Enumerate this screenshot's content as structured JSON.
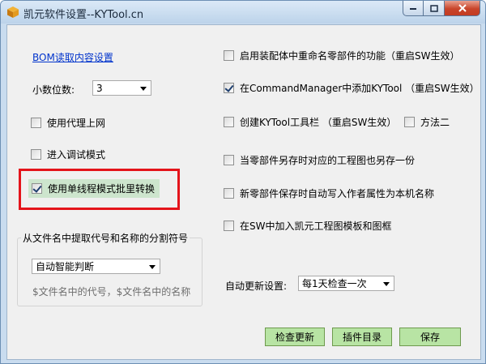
{
  "window": {
    "title": "凯元软件设置--KYTool.cn"
  },
  "left": {
    "bom_link": "BOM读取内容设置",
    "decimal_label": "小数位数:",
    "decimal_value": "3",
    "proxy_label": "使用代理上网",
    "proxy_checked": false,
    "debug_label": "进入调试模式",
    "debug_checked": false,
    "single_thread_label": "使用单线程模式批里转换",
    "single_thread_checked": true
  },
  "separator_group": {
    "title": "从文件名中提取代号和名称的分割符号",
    "selected": "自动智能判断",
    "hint": "$文件名中的代号，$文件名中的名称"
  },
  "right": {
    "opt1": {
      "label": "启用装配体中重命名零部件的功能（重启SW生效）",
      "checked": false
    },
    "opt2": {
      "label": "在CommandManager中添加KYTool （重启SW生效）",
      "checked": true
    },
    "opt3": {
      "label": "创建KYTool工具栏 （重启SW生效）",
      "checked": false
    },
    "opt3b": {
      "label": "方法二",
      "checked": false
    },
    "opt4": {
      "label": "当零部件另存时对应的工程图也另存一份",
      "checked": false
    },
    "opt5": {
      "label": "新零部件保存时自动写入作者属性为本机名称",
      "checked": false
    },
    "opt6": {
      "label": "在SW中加入凯元工程图模板和图框",
      "checked": false
    }
  },
  "update": {
    "label": "自动更新设置:",
    "selected": "每1天检查一次"
  },
  "buttons": {
    "check_update": "检查更新",
    "plugin_dir": "插件目录",
    "save": "保存"
  },
  "colors": {
    "highlight_border": "#e4141b",
    "button_green": "#b8e4a4",
    "link": "#0033cc"
  }
}
